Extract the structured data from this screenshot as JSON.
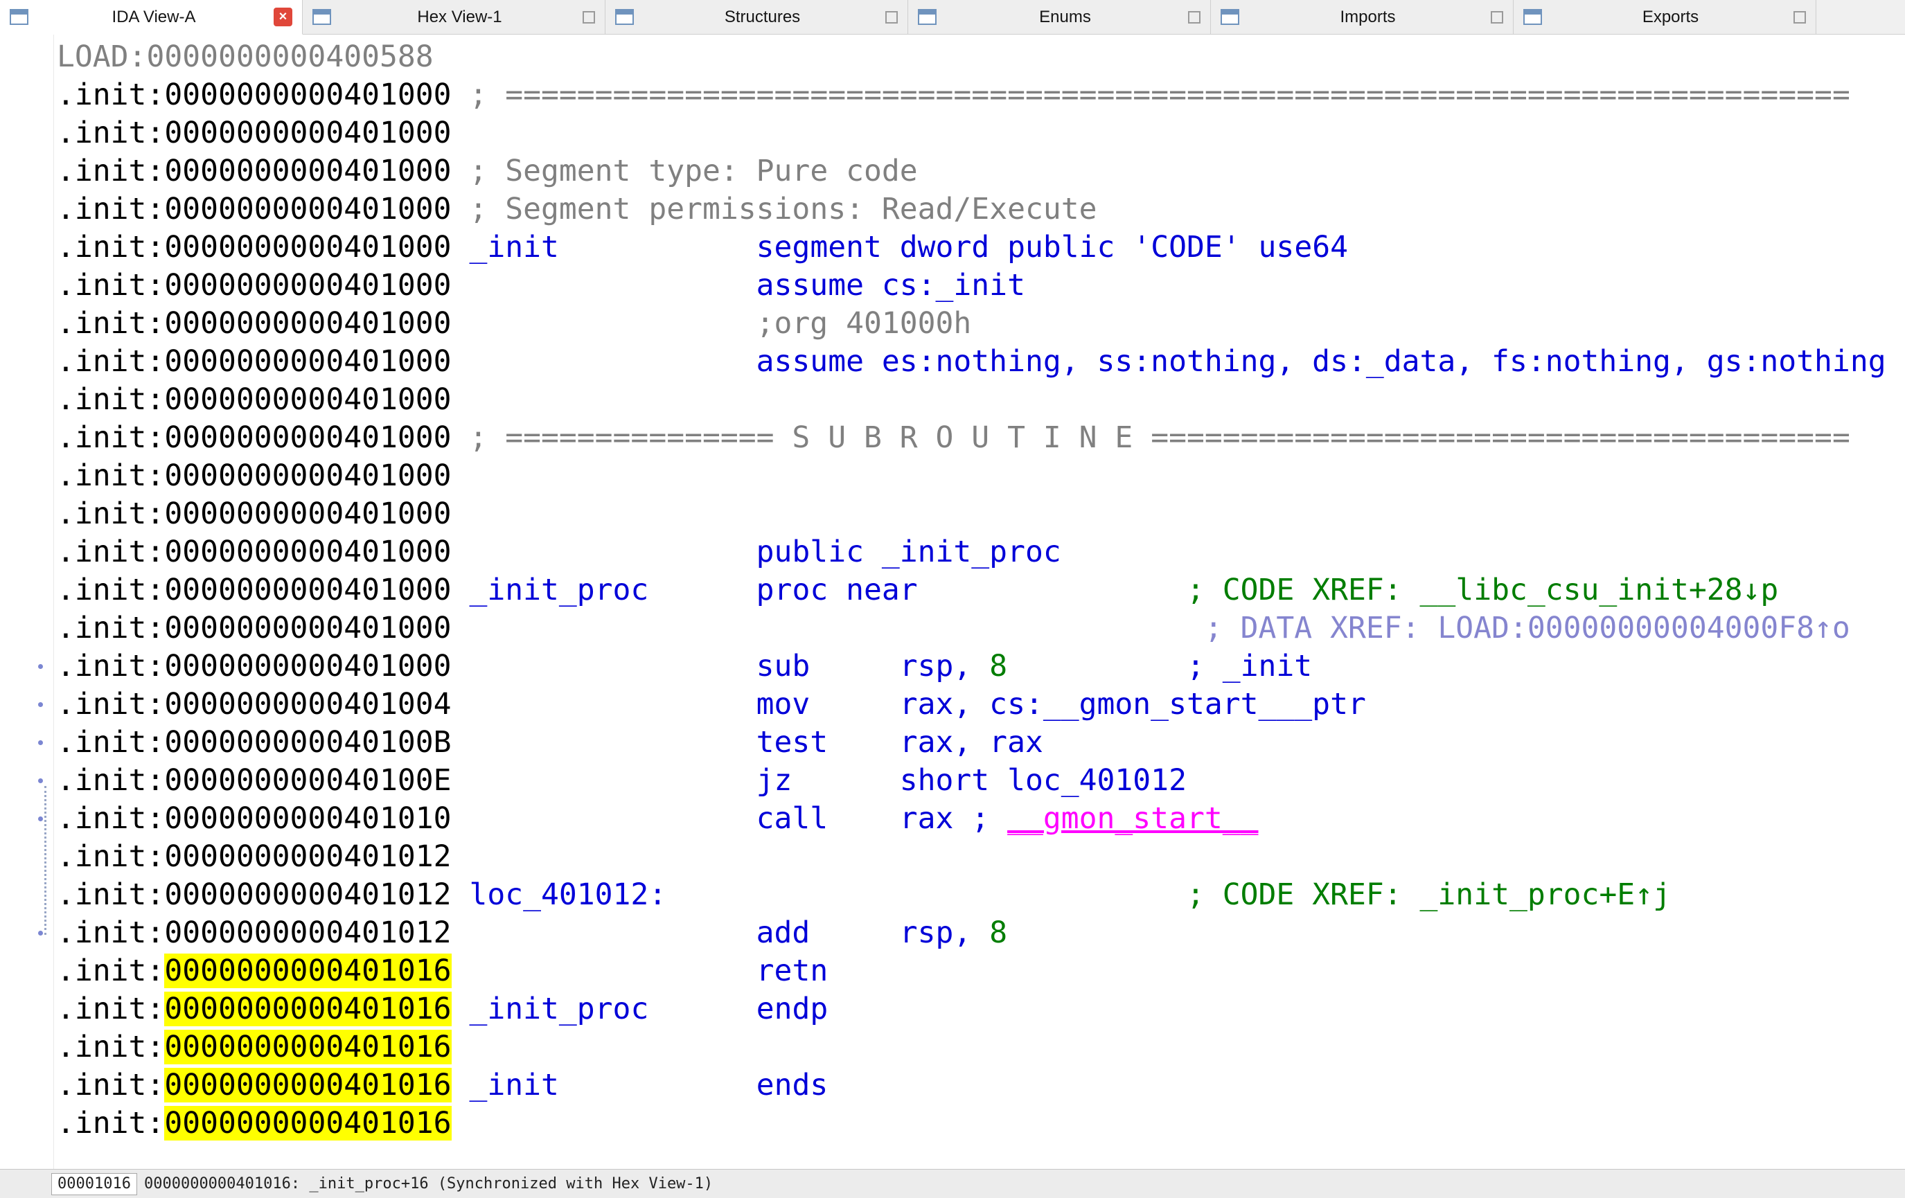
{
  "tabs": [
    {
      "label": "IDA View-A",
      "active": true
    },
    {
      "label": "Hex View-1",
      "active": false
    },
    {
      "label": "Structures",
      "active": false
    },
    {
      "label": "Enums",
      "active": false
    },
    {
      "label": "Imports",
      "active": false
    },
    {
      "label": "Exports",
      "active": false
    }
  ],
  "tab_close_glyph": "×",
  "colors": {
    "address": "#000000",
    "comment": "#808080",
    "keyword": "#0000d8",
    "green": "#007d00",
    "lavender": "#8585cf",
    "magenta": "#ff00ff",
    "highlight": "#ffff00"
  },
  "listing": {
    "lines": [
      {
        "segs": [
          [
            "LOAD:0000000000400588",
            "c"
          ]
        ]
      },
      {
        "segs": [
          [
            ".init:0000000000401000 ",
            "a"
          ],
          [
            "; ===========================================================================",
            "c"
          ]
        ]
      },
      {
        "segs": [
          [
            ".init:0000000000401000",
            "a"
          ]
        ]
      },
      {
        "segs": [
          [
            ".init:0000000000401000 ",
            "a"
          ],
          [
            "; Segment type: Pure code",
            "c"
          ]
        ]
      },
      {
        "segs": [
          [
            ".init:0000000000401000 ",
            "a"
          ],
          [
            "; Segment permissions: Read/Execute",
            "c"
          ]
        ]
      },
      {
        "segs": [
          [
            ".init:0000000000401000 ",
            "a"
          ],
          [
            "_init",
            "b"
          ],
          [
            "           ",
            "a"
          ],
          [
            "segment dword public 'CODE' use64",
            "b"
          ]
        ]
      },
      {
        "segs": [
          [
            ".init:0000000000401000                 ",
            "a"
          ],
          [
            "assume cs:_init",
            "b"
          ]
        ]
      },
      {
        "segs": [
          [
            ".init:0000000000401000                 ",
            "a"
          ],
          [
            ";org 401000h",
            "c"
          ]
        ]
      },
      {
        "segs": [
          [
            ".init:0000000000401000                 ",
            "a"
          ],
          [
            "assume es:nothing, ss:nothing, ds:_data, fs:nothing, gs:nothing",
            "b"
          ]
        ]
      },
      {
        "segs": [
          [
            ".init:0000000000401000",
            "a"
          ]
        ]
      },
      {
        "segs": [
          [
            ".init:0000000000401000 ",
            "a"
          ],
          [
            "; =============== S U B R O U T I N E =======================================",
            "c"
          ]
        ]
      },
      {
        "segs": [
          [
            ".init:0000000000401000",
            "a"
          ]
        ]
      },
      {
        "segs": [
          [
            ".init:0000000000401000",
            "a"
          ]
        ]
      },
      {
        "segs": [
          [
            ".init:0000000000401000                 ",
            "a"
          ],
          [
            "public _init_proc",
            "b"
          ]
        ]
      },
      {
        "segs": [
          [
            ".init:0000000000401000 ",
            "a"
          ],
          [
            "_init_proc",
            "b"
          ],
          [
            "      ",
            "a"
          ],
          [
            "proc near",
            "b"
          ],
          [
            "               ",
            "a"
          ],
          [
            "; CODE XREF: __libc_csu_init+28↓p",
            "g"
          ]
        ]
      },
      {
        "segs": [
          [
            ".init:0000000000401000                                          ",
            "a"
          ],
          [
            "; DATA XREF: LOAD:00000000004000F8↑o",
            "v"
          ]
        ]
      },
      {
        "dot": true,
        "segs": [
          [
            ".init:0000000000401000                 ",
            "a"
          ],
          [
            "sub     rsp, ",
            "b"
          ],
          [
            "8",
            "g"
          ],
          [
            "          ",
            "a"
          ],
          [
            "; _init",
            "b"
          ]
        ]
      },
      {
        "dot": true,
        "segs": [
          [
            ".init:0000000000401004                 ",
            "a"
          ],
          [
            "mov     rax, cs:__gmon_start___ptr",
            "b"
          ]
        ]
      },
      {
        "dot": true,
        "segs": [
          [
            ".init:000000000040100B                 ",
            "a"
          ],
          [
            "test    rax, rax",
            "b"
          ]
        ]
      },
      {
        "dot": true,
        "segs": [
          [
            ".init:000000000040100E                 ",
            "a"
          ],
          [
            "jz      short loc_401012",
            "b"
          ]
        ]
      },
      {
        "dot": true,
        "segs": [
          [
            ".init:0000000000401010                 ",
            "a"
          ],
          [
            "call    rax ; ",
            "b"
          ],
          [
            "__gmon_start__",
            "m"
          ]
        ]
      },
      {
        "segs": [
          [
            ".init:0000000000401012",
            "a"
          ]
        ]
      },
      {
        "segs": [
          [
            ".init:0000000000401012 ",
            "a"
          ],
          [
            "loc_401012:",
            "b"
          ],
          [
            "                             ",
            "a"
          ],
          [
            "; CODE XREF: _init_proc+E↑j",
            "g"
          ]
        ]
      },
      {
        "dot": true,
        "segs": [
          [
            ".init:0000000000401012                 ",
            "a"
          ],
          [
            "add     rsp, ",
            "b"
          ],
          [
            "8",
            "g"
          ]
        ]
      },
      {
        "segs": [
          [
            ".init:",
            "a"
          ],
          [
            "0000000000401016",
            "hl"
          ],
          [
            "                 ",
            "a"
          ],
          [
            "retn",
            "b"
          ]
        ]
      },
      {
        "segs": [
          [
            ".init:",
            "a"
          ],
          [
            "0000000000401016",
            "hl"
          ],
          [
            " ",
            "a"
          ],
          [
            "_init_proc",
            "b"
          ],
          [
            "      ",
            "a"
          ],
          [
            "endp",
            "b"
          ]
        ]
      },
      {
        "segs": [
          [
            ".init:",
            "a"
          ],
          [
            "0000000000401016",
            "hl"
          ]
        ]
      },
      {
        "segs": [
          [
            ".init:",
            "a"
          ],
          [
            "0000000000401016",
            "hl"
          ],
          [
            " ",
            "a"
          ],
          [
            "_init",
            "b"
          ],
          [
            "           ",
            "a"
          ],
          [
            "ends",
            "b"
          ]
        ]
      },
      {
        "segs": [
          [
            ".init:",
            "a"
          ],
          [
            "0000000000401016",
            "hl"
          ]
        ]
      }
    ]
  },
  "status_bar": {
    "offset": "00001016",
    "text": "0000000000401016: _init_proc+16 (Synchronized with Hex View-1)"
  }
}
